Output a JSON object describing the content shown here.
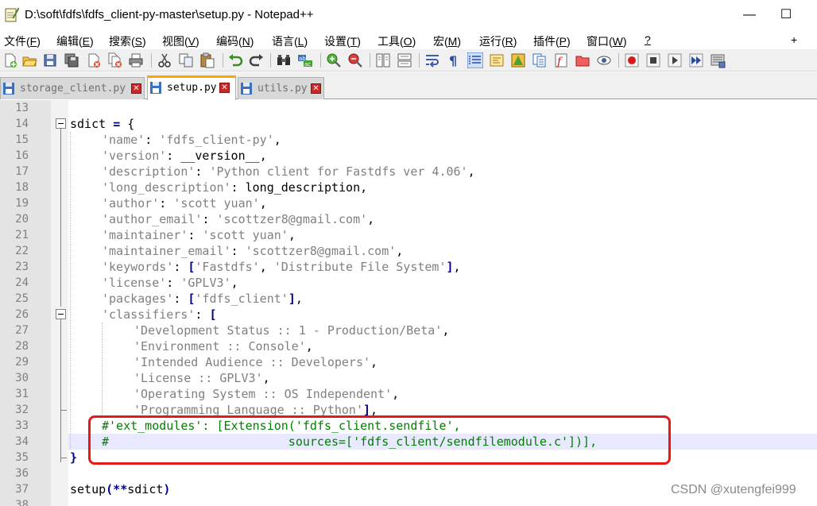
{
  "window": {
    "title": "D:\\soft\\fdfs\\fdfs_client-py-master\\setup.py - Notepad++",
    "minimize": "—",
    "maximize": "☐"
  },
  "menu": [
    {
      "label": "文件(",
      "key": "F",
      "end": ")"
    },
    {
      "label": "编辑(",
      "key": "E",
      "end": ")"
    },
    {
      "label": "搜索(",
      "key": "S",
      "end": ")"
    },
    {
      "label": "视图(",
      "key": "V",
      "end": ")"
    },
    {
      "label": "编码(",
      "key": "N",
      "end": ")"
    },
    {
      "label": "语言(",
      "key": "L",
      "end": ")"
    },
    {
      "label": "设置(",
      "key": "T",
      "end": ")"
    },
    {
      "label": "工具(",
      "key": "O",
      "end": ")"
    },
    {
      "label": "宏(",
      "key": "M",
      "end": ")"
    },
    {
      "label": "运行(",
      "key": "R",
      "end": ")"
    },
    {
      "label": "插件(",
      "key": "P",
      "end": ")"
    },
    {
      "label": "窗口(",
      "key": "W",
      "end": ")"
    },
    {
      "label": "",
      "key": "?",
      "end": ""
    }
  ],
  "menu_extra": {
    "plus": "+",
    "close": "✕"
  },
  "toolbar_icons": [
    "new-file-icon",
    "open-file-icon",
    "save-icon",
    "save-all-icon",
    "close-icon",
    "close-all-icon",
    "print-icon",
    "cut-icon",
    "copy-icon",
    "paste-icon",
    "undo-icon",
    "redo-icon",
    "find-icon",
    "replace-icon",
    "zoom-in-icon",
    "zoom-out-icon",
    "sync-vertical-icon",
    "sync-horizontal-icon",
    "word-wrap-icon",
    "show-all-chars-icon",
    "indent-guide-icon",
    "udl-icon",
    "doc-map-icon",
    "doc-list-icon",
    "function-list-icon",
    "folder-workspace-icon",
    "monitoring-icon",
    "record-macro-icon",
    "stop-macro-icon",
    "play-macro-icon",
    "run-macro-multiple-icon",
    "save-macro-icon"
  ],
  "tabs": [
    {
      "label": "storage_client.py",
      "active": false
    },
    {
      "label": "setup.py",
      "active": true
    },
    {
      "label": "utils.py",
      "active": false
    }
  ],
  "line_numbers": [
    "13",
    "14",
    "15",
    "16",
    "17",
    "18",
    "19",
    "20",
    "21",
    "22",
    "23",
    "24",
    "25",
    "26",
    "27",
    "28",
    "29",
    "30",
    "31",
    "32",
    "33",
    "34",
    "35",
    "36",
    "37",
    "38"
  ],
  "code": {
    "l14": {
      "a": "sdict ",
      "b": "=",
      "c": " {"
    },
    "l15": {
      "s": "'name'",
      "p": ": ",
      "v": "'fdfs_client-py'",
      "e": ","
    },
    "l16": {
      "s": "'version'",
      "p": ": ",
      "v": "__version__",
      "e": ","
    },
    "l17": {
      "s": "'description'",
      "p": ": ",
      "v": "'Python client for Fastdfs ver 4.06'",
      "e": ","
    },
    "l18": {
      "s": "'long_description'",
      "p": ": ",
      "v": "long_description",
      "e": ","
    },
    "l19": {
      "s": "'author'",
      "p": ": ",
      "v": "'scott yuan'",
      "e": ","
    },
    "l20": {
      "s": "'author_email'",
      "p": ": ",
      "v": "'scottzer8@gmail.com'",
      "e": ","
    },
    "l21": {
      "s": "'maintainer'",
      "p": ": ",
      "v": "'scott yuan'",
      "e": ","
    },
    "l22": {
      "s": "'maintainer_email'",
      "p": ": ",
      "v": "'scottzer8@gmail.com'",
      "e": ","
    },
    "l23": {
      "s": "'keywords'",
      "p": ": ",
      "o": "[",
      "v1": "'Fastdfs'",
      "m": ", ",
      "v2": "'Distribute File System'",
      "c": "]",
      "e": ","
    },
    "l24": {
      "s": "'license'",
      "p": ": ",
      "v": "'GPLV3'",
      "e": ","
    },
    "l25": {
      "s": "'packages'",
      "p": ": ",
      "o": "[",
      "v": "'fdfs_client'",
      "c": "]",
      "e": ","
    },
    "l26": {
      "s": "'classifiers'",
      "p": ": ",
      "o": "["
    },
    "l27": {
      "v": "'Development Status :: 1 - Production/Beta'",
      "e": ","
    },
    "l28": {
      "v": "'Environment :: Console'",
      "e": ","
    },
    "l29": {
      "v": "'Intended Audience :: Developers'",
      "e": ","
    },
    "l30": {
      "v": "'License :: GPLV3'",
      "e": ","
    },
    "l31": {
      "v": "'Operating System :: OS Independent'",
      "e": ","
    },
    "l32": {
      "v": "'Programming Language :: Python'",
      "c": "]",
      "e": ","
    },
    "l33": "#'ext_modules': [Extension('fdfs_client.sendfile',",
    "l34": "#                         sources=['fdfs_client/sendfilemodule.c'])],",
    "l35": "}",
    "l37": {
      "a": "setup",
      "b": "(**",
      "c": "sdict",
      "d": ")"
    }
  },
  "watermark": "CSDN @xutengfei999",
  "colors": {
    "string": "#808080",
    "operator": "#000080",
    "comment": "#008000",
    "highlight": "#e8e8ff",
    "annotation_box": "#e81818",
    "active_tab_accent": "#fea500"
  }
}
